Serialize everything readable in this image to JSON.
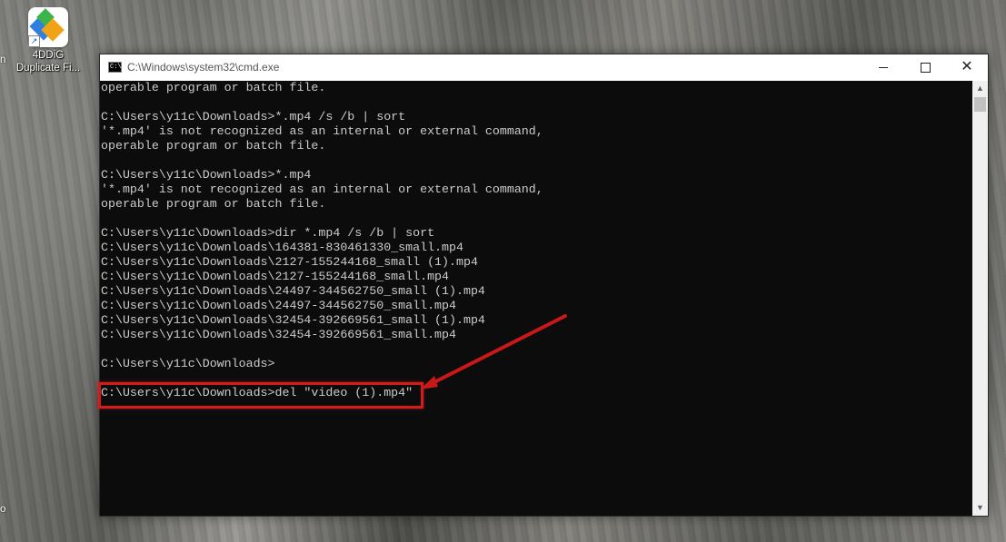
{
  "desktop": {
    "icon_label_line1": "4DDiG",
    "icon_label_line2": "Duplicate Fi...",
    "edge_left_text": "n",
    "edge_bottom_text": "o"
  },
  "window": {
    "title": "C:\\Windows\\system32\\cmd.exe",
    "icon_glyph": "C:\\",
    "controls": {
      "close_glyph": "✕"
    }
  },
  "console": {
    "lines": [
      "operable program or batch file.",
      "",
      "C:\\Users\\y11c\\Downloads>*.mp4 /s /b | sort",
      "'*.mp4' is not recognized as an internal or external command,",
      "operable program or batch file.",
      "",
      "C:\\Users\\y11c\\Downloads>*.mp4",
      "'*.mp4' is not recognized as an internal or external command,",
      "operable program or batch file.",
      "",
      "C:\\Users\\y11c\\Downloads>dir *.mp4 /s /b | sort",
      "C:\\Users\\y11c\\Downloads\\164381-830461330_small.mp4",
      "C:\\Users\\y11c\\Downloads\\2127-155244168_small (1).mp4",
      "C:\\Users\\y11c\\Downloads\\2127-155244168_small.mp4",
      "C:\\Users\\y11c\\Downloads\\24497-344562750_small (1).mp4",
      "C:\\Users\\y11c\\Downloads\\24497-344562750_small.mp4",
      "C:\\Users\\y11c\\Downloads\\32454-392669561_small (1).mp4",
      "C:\\Users\\y11c\\Downloads\\32454-392669561_small.mp4",
      "",
      "C:\\Users\\y11c\\Downloads>",
      "",
      "C:\\Users\\y11c\\Downloads>del \"video (1).mp4\""
    ]
  },
  "scrollbar": {
    "up_glyph": "▲",
    "down_glyph": "▼"
  },
  "annotation": {
    "color": "#d11c1c"
  }
}
